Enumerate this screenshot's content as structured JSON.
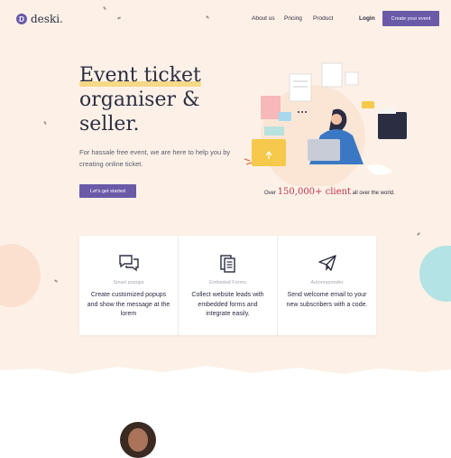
{
  "brand": {
    "name": "deski.",
    "mark": "D",
    "accent": "#6a5aa8"
  },
  "nav": {
    "links": [
      "About us",
      "Pricing",
      "Product"
    ],
    "login": "Login",
    "cta": "Create your event"
  },
  "hero": {
    "title_lines": [
      "Event ticket",
      "organiser &",
      "seller."
    ],
    "subtitle": "For hassale free event, we are here to help you by creating online ticket.",
    "cta": "Let's get started",
    "clients_prefix": "Over",
    "clients_count": "150,000+ client",
    "clients_suffix": "all over the world."
  },
  "features": [
    {
      "icon": "chat-bubbles-icon",
      "title": "Smart popups",
      "desc": "Create customized popups and show the message at the lorem"
    },
    {
      "icon": "documents-icon",
      "title": "Embeded Forms",
      "desc": "Collect website leads with embedded forms and integrate easily."
    },
    {
      "icon": "paper-plane-icon",
      "title": "Autoresponder",
      "desc": "Send welcome email to your new subscribers with a code."
    }
  ],
  "colors": {
    "hero_bg": "#fdf1e7",
    "highlight": "#f6d986",
    "client_count": "#c0334d"
  }
}
